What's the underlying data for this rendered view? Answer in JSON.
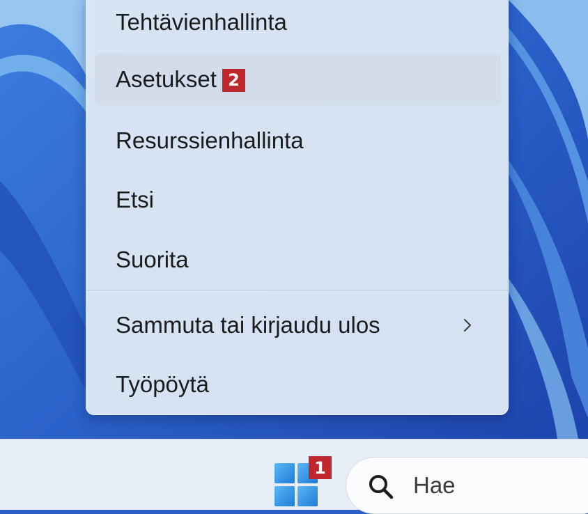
{
  "context_menu": {
    "items": [
      {
        "label": "Tehtävienhallinta"
      },
      {
        "label": "Asetukset",
        "badge": "2"
      },
      {
        "label": "Resurssienhallinta"
      },
      {
        "label": "Etsi"
      },
      {
        "label": "Suorita"
      },
      {
        "label": "Sammuta tai kirjaudu ulos",
        "chevron": "chevron-right-icon"
      },
      {
        "label": "Työpöytä"
      }
    ]
  },
  "taskbar": {
    "start_badge": "1",
    "search": {
      "placeholder": "Hae",
      "icon": "search-icon"
    }
  },
  "colors": {
    "badge": "#c0272d",
    "menu_background": "#dee8f5",
    "wallpaper": "#2a5fc8",
    "start_logo": "#2f8fe0"
  }
}
